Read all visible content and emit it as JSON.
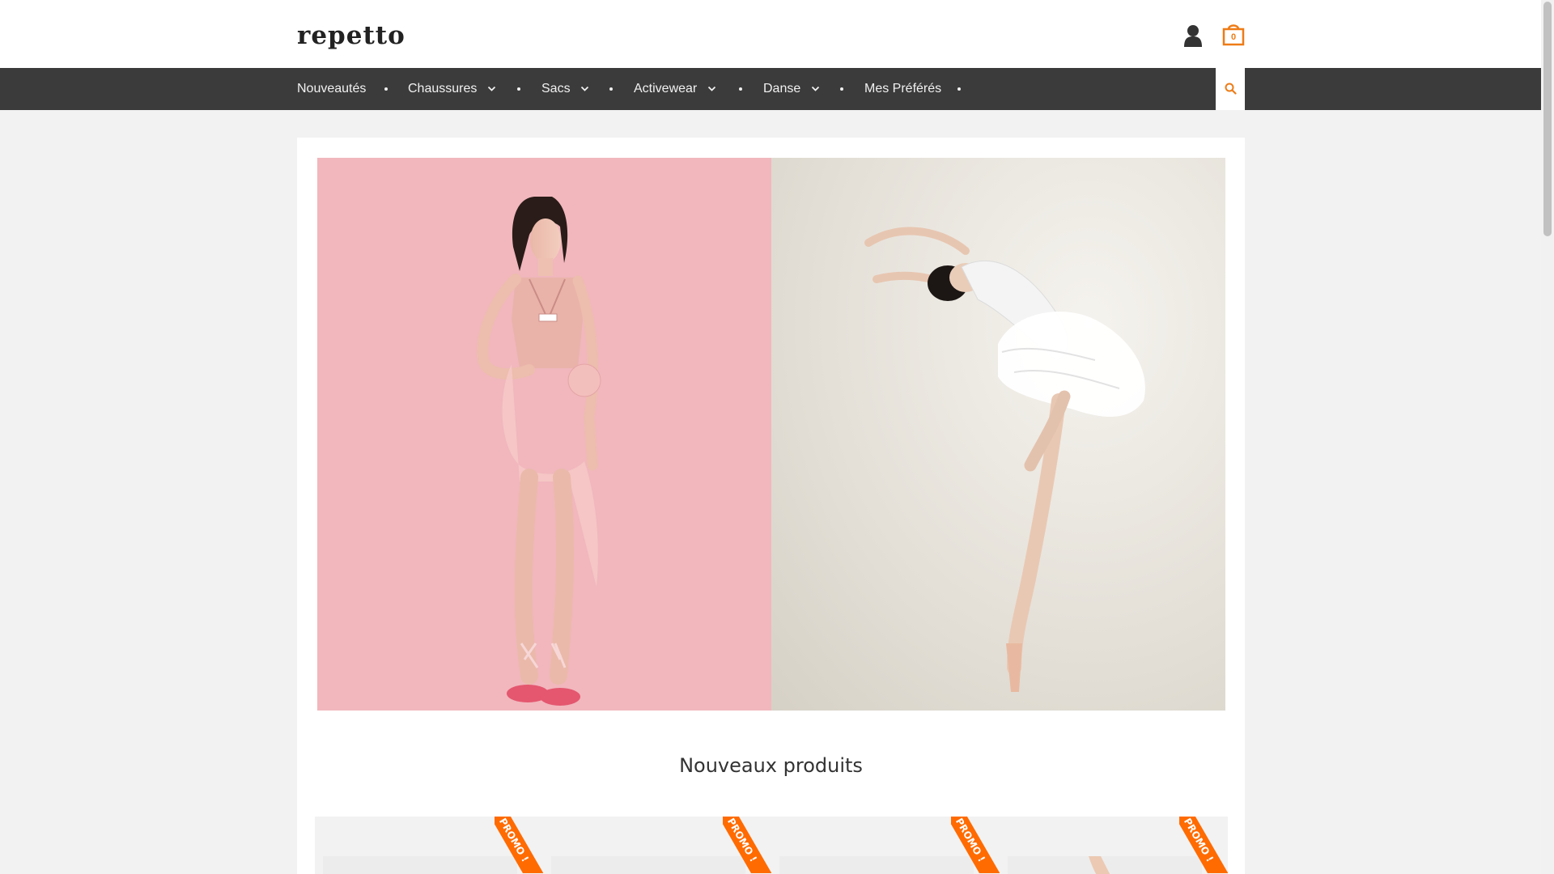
{
  "header": {
    "logo_text": "repetto",
    "cart_count": "0"
  },
  "nav": {
    "items": [
      {
        "label": "Nouveautés",
        "has_dropdown": false
      },
      {
        "label": "Chaussures",
        "has_dropdown": true
      },
      {
        "label": "Sacs",
        "has_dropdown": true
      },
      {
        "label": "Activewear",
        "has_dropdown": true
      },
      {
        "label": "Danse",
        "has_dropdown": true
      },
      {
        "label": "Mes Préférés",
        "has_dropdown": false
      }
    ],
    "search_icon": "search-icon"
  },
  "main": {
    "section_title": "Nouveaux produits",
    "products": [
      {
        "badge": "PROMO !"
      },
      {
        "badge": "PROMO !"
      },
      {
        "badge": "PROMO !"
      },
      {
        "badge": "PROMO !"
      }
    ]
  },
  "colors": {
    "accent": "#ee7b16",
    "promo": "#ff6b00",
    "nav_bg": "#3b3b3b",
    "hero_left_bg": "#f1b7bd"
  }
}
